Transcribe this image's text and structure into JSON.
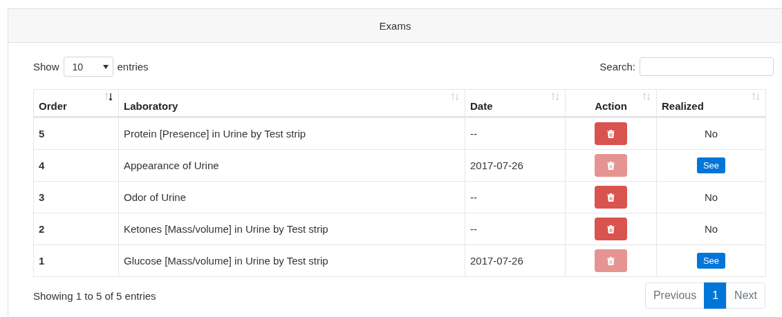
{
  "card": {
    "title": "Exams"
  },
  "length_menu": {
    "before": "Show",
    "value": "10",
    "after": "entries"
  },
  "search": {
    "label": "Search:"
  },
  "table": {
    "columns": [
      {
        "label": "Order",
        "sorted": true
      },
      {
        "label": "Laboratory",
        "sorted": false
      },
      {
        "label": "Date",
        "sorted": false
      },
      {
        "label": "Action",
        "sorted": false
      },
      {
        "label": "Realized",
        "sorted": false
      }
    ],
    "rows": [
      {
        "order": "5",
        "laboratory": "Protein [Presence] in Urine by Test strip",
        "date": "--",
        "delete_disabled": false,
        "realized": {
          "kind": "text",
          "label": "No"
        }
      },
      {
        "order": "4",
        "laboratory": "Appearance of Urine",
        "date": "2017-07-26",
        "delete_disabled": true,
        "realized": {
          "kind": "button",
          "label": "See"
        }
      },
      {
        "order": "3",
        "laboratory": "Odor of Urine",
        "date": "--",
        "delete_disabled": false,
        "realized": {
          "kind": "text",
          "label": "No"
        }
      },
      {
        "order": "2",
        "laboratory": "Ketones [Mass/volume] in Urine by Test strip",
        "date": "--",
        "delete_disabled": false,
        "realized": {
          "kind": "text",
          "label": "No"
        }
      },
      {
        "order": "1",
        "laboratory": "Glucose [Mass/volume] in Urine by Test strip",
        "date": "2017-07-26",
        "delete_disabled": true,
        "realized": {
          "kind": "button",
          "label": "See"
        }
      }
    ]
  },
  "info": "Showing 1 to 5 of 5 entries",
  "pagination": [
    {
      "label": "Previous",
      "selected": false
    },
    {
      "label": "1",
      "selected": true
    },
    {
      "label": "Next",
      "selected": false
    }
  ]
}
